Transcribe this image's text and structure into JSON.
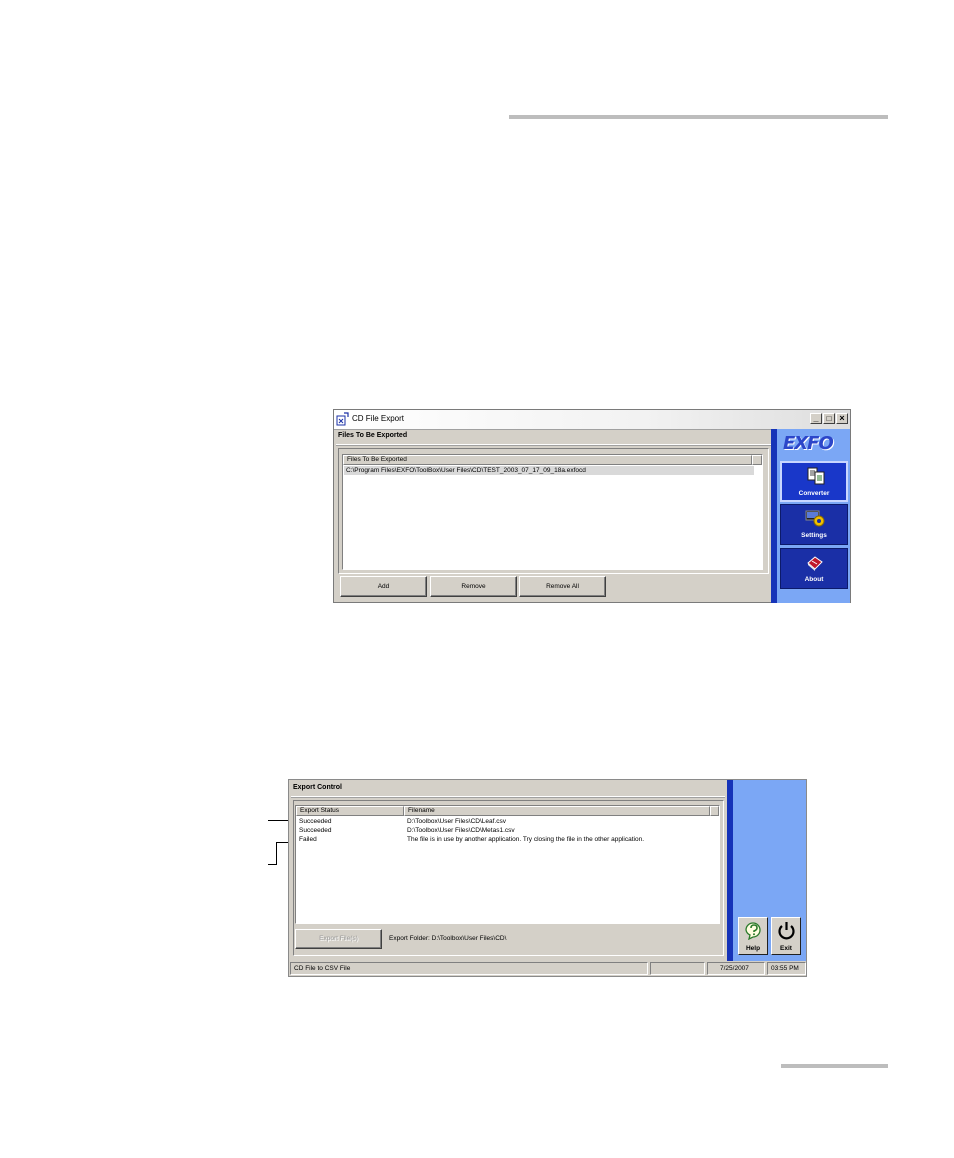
{
  "window1": {
    "title": "CD File Export",
    "caption_minimize": "_",
    "caption_maximize": "□",
    "caption_close": "×",
    "panel_header": "Files To Be Exported",
    "list_column": "Files To Be Exported",
    "files": [
      "C:\\Program Files\\EXFO\\ToolBox\\User Files\\CD\\TEST_2003_07_17_09_18a.exfocd"
    ],
    "buttons": {
      "add": "Add",
      "remove": "Remove",
      "remove_all": "Remove All"
    },
    "logo": "EXFO",
    "nav": [
      {
        "label": "Converter",
        "icon": "converter-icon"
      },
      {
        "label": "Settings",
        "icon": "settings-icon"
      },
      {
        "label": "About",
        "icon": "about-book-icon"
      }
    ],
    "colors": {
      "sidebar": "#7ba7f5",
      "sidebar_bar": "#1633b8",
      "nav_button": "#1a2fa6"
    }
  },
  "window2": {
    "panel_header": "Export Control",
    "columns": {
      "status": "Export Status",
      "filename": "Filename"
    },
    "rows": [
      {
        "status": "Succeeded",
        "filename": "D:\\Toolbox\\User Files\\CD\\Leaf.csv"
      },
      {
        "status": "Succeeded",
        "filename": "D:\\Toolbox\\User Files\\CD\\Metas1.csv"
      },
      {
        "status": "Failed",
        "filename": "The file is in use by another application. Try closing the file in the other application."
      }
    ],
    "export_button": "Export File(s)",
    "export_folder": "Export Folder: D:\\Toolbox\\User Files\\CD\\",
    "help": "Help",
    "exit": "Exit",
    "statusbar": {
      "app": "CD File to CSV File",
      "date": "7/25/2007",
      "time": "03:55 PM"
    }
  }
}
